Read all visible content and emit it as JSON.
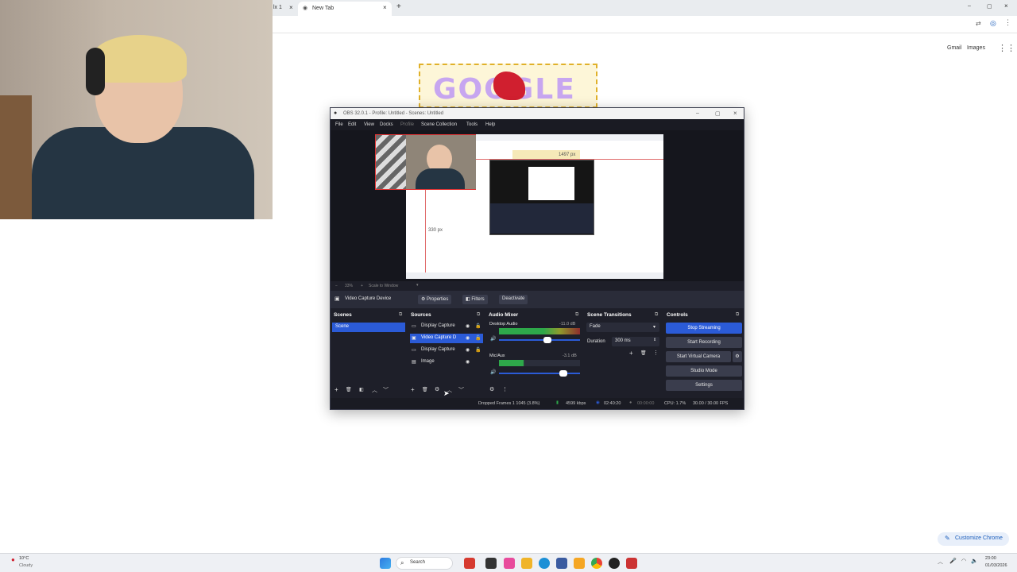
{
  "browser": {
    "tabs": [
      {
        "label": "lx 1"
      },
      {
        "label": "New Tab"
      }
    ],
    "links": {
      "gmail": "Gmail",
      "images": "Images"
    },
    "customize_label": "Customize Chrome"
  },
  "doodle": {
    "text": "GOOGLE"
  },
  "obs": {
    "title": "OBS 32.0.1 - Profile: Untitled - Scenes: Untitled",
    "menu": [
      "File",
      "Edit",
      "View",
      "Docks",
      "Profile",
      "Scene Collection",
      "Tools",
      "Help"
    ],
    "preview": {
      "measure_right": "1497 px",
      "measure_bottom": "330 px",
      "zoom": "33%",
      "scale_label": "Scale to Window"
    },
    "source_bar": {
      "selected_source": "Video Capture Device",
      "properties": "Properties",
      "filters": "Filters",
      "deactivate": "Deactivate"
    },
    "scenes": {
      "title": "Scenes",
      "items": [
        "Scene"
      ]
    },
    "sources": {
      "title": "Sources",
      "items": [
        "Display Capture",
        "Video Capture D",
        "Display Capture",
        "Image"
      ]
    },
    "audio_mixer": {
      "title": "Audio Mixer",
      "channels": [
        {
          "name": "Desktop Audio",
          "db": "-11.0 dB"
        },
        {
          "name": "Mic/Aux",
          "db": "-3.1 dB"
        }
      ]
    },
    "transitions": {
      "title": "Scene Transitions",
      "selected": "Fade",
      "duration_label": "Duration",
      "duration_value": "300 ms"
    },
    "controls": {
      "title": "Controls",
      "stop_streaming": "Stop Streaming",
      "start_recording": "Start Recording",
      "start_virtual_camera": "Start Virtual Camera",
      "studio_mode": "Studio Mode",
      "settings": "Settings"
    },
    "status": {
      "dropped": "Dropped Frames 1 1045 (3.8%)",
      "kbps": "4599 kbps",
      "stream_time": "02:40:20",
      "rec_time": "00:00:00",
      "cpu": "CPU: 1.7%",
      "fps": "30.00 / 30.00 FPS"
    },
    "accent_color": "#2b5bd7"
  },
  "taskbar": {
    "weather_temp": "10°C",
    "weather_desc": "Cloudy",
    "search_label": "Search",
    "time": "23:00",
    "date": "01/03/2026"
  }
}
